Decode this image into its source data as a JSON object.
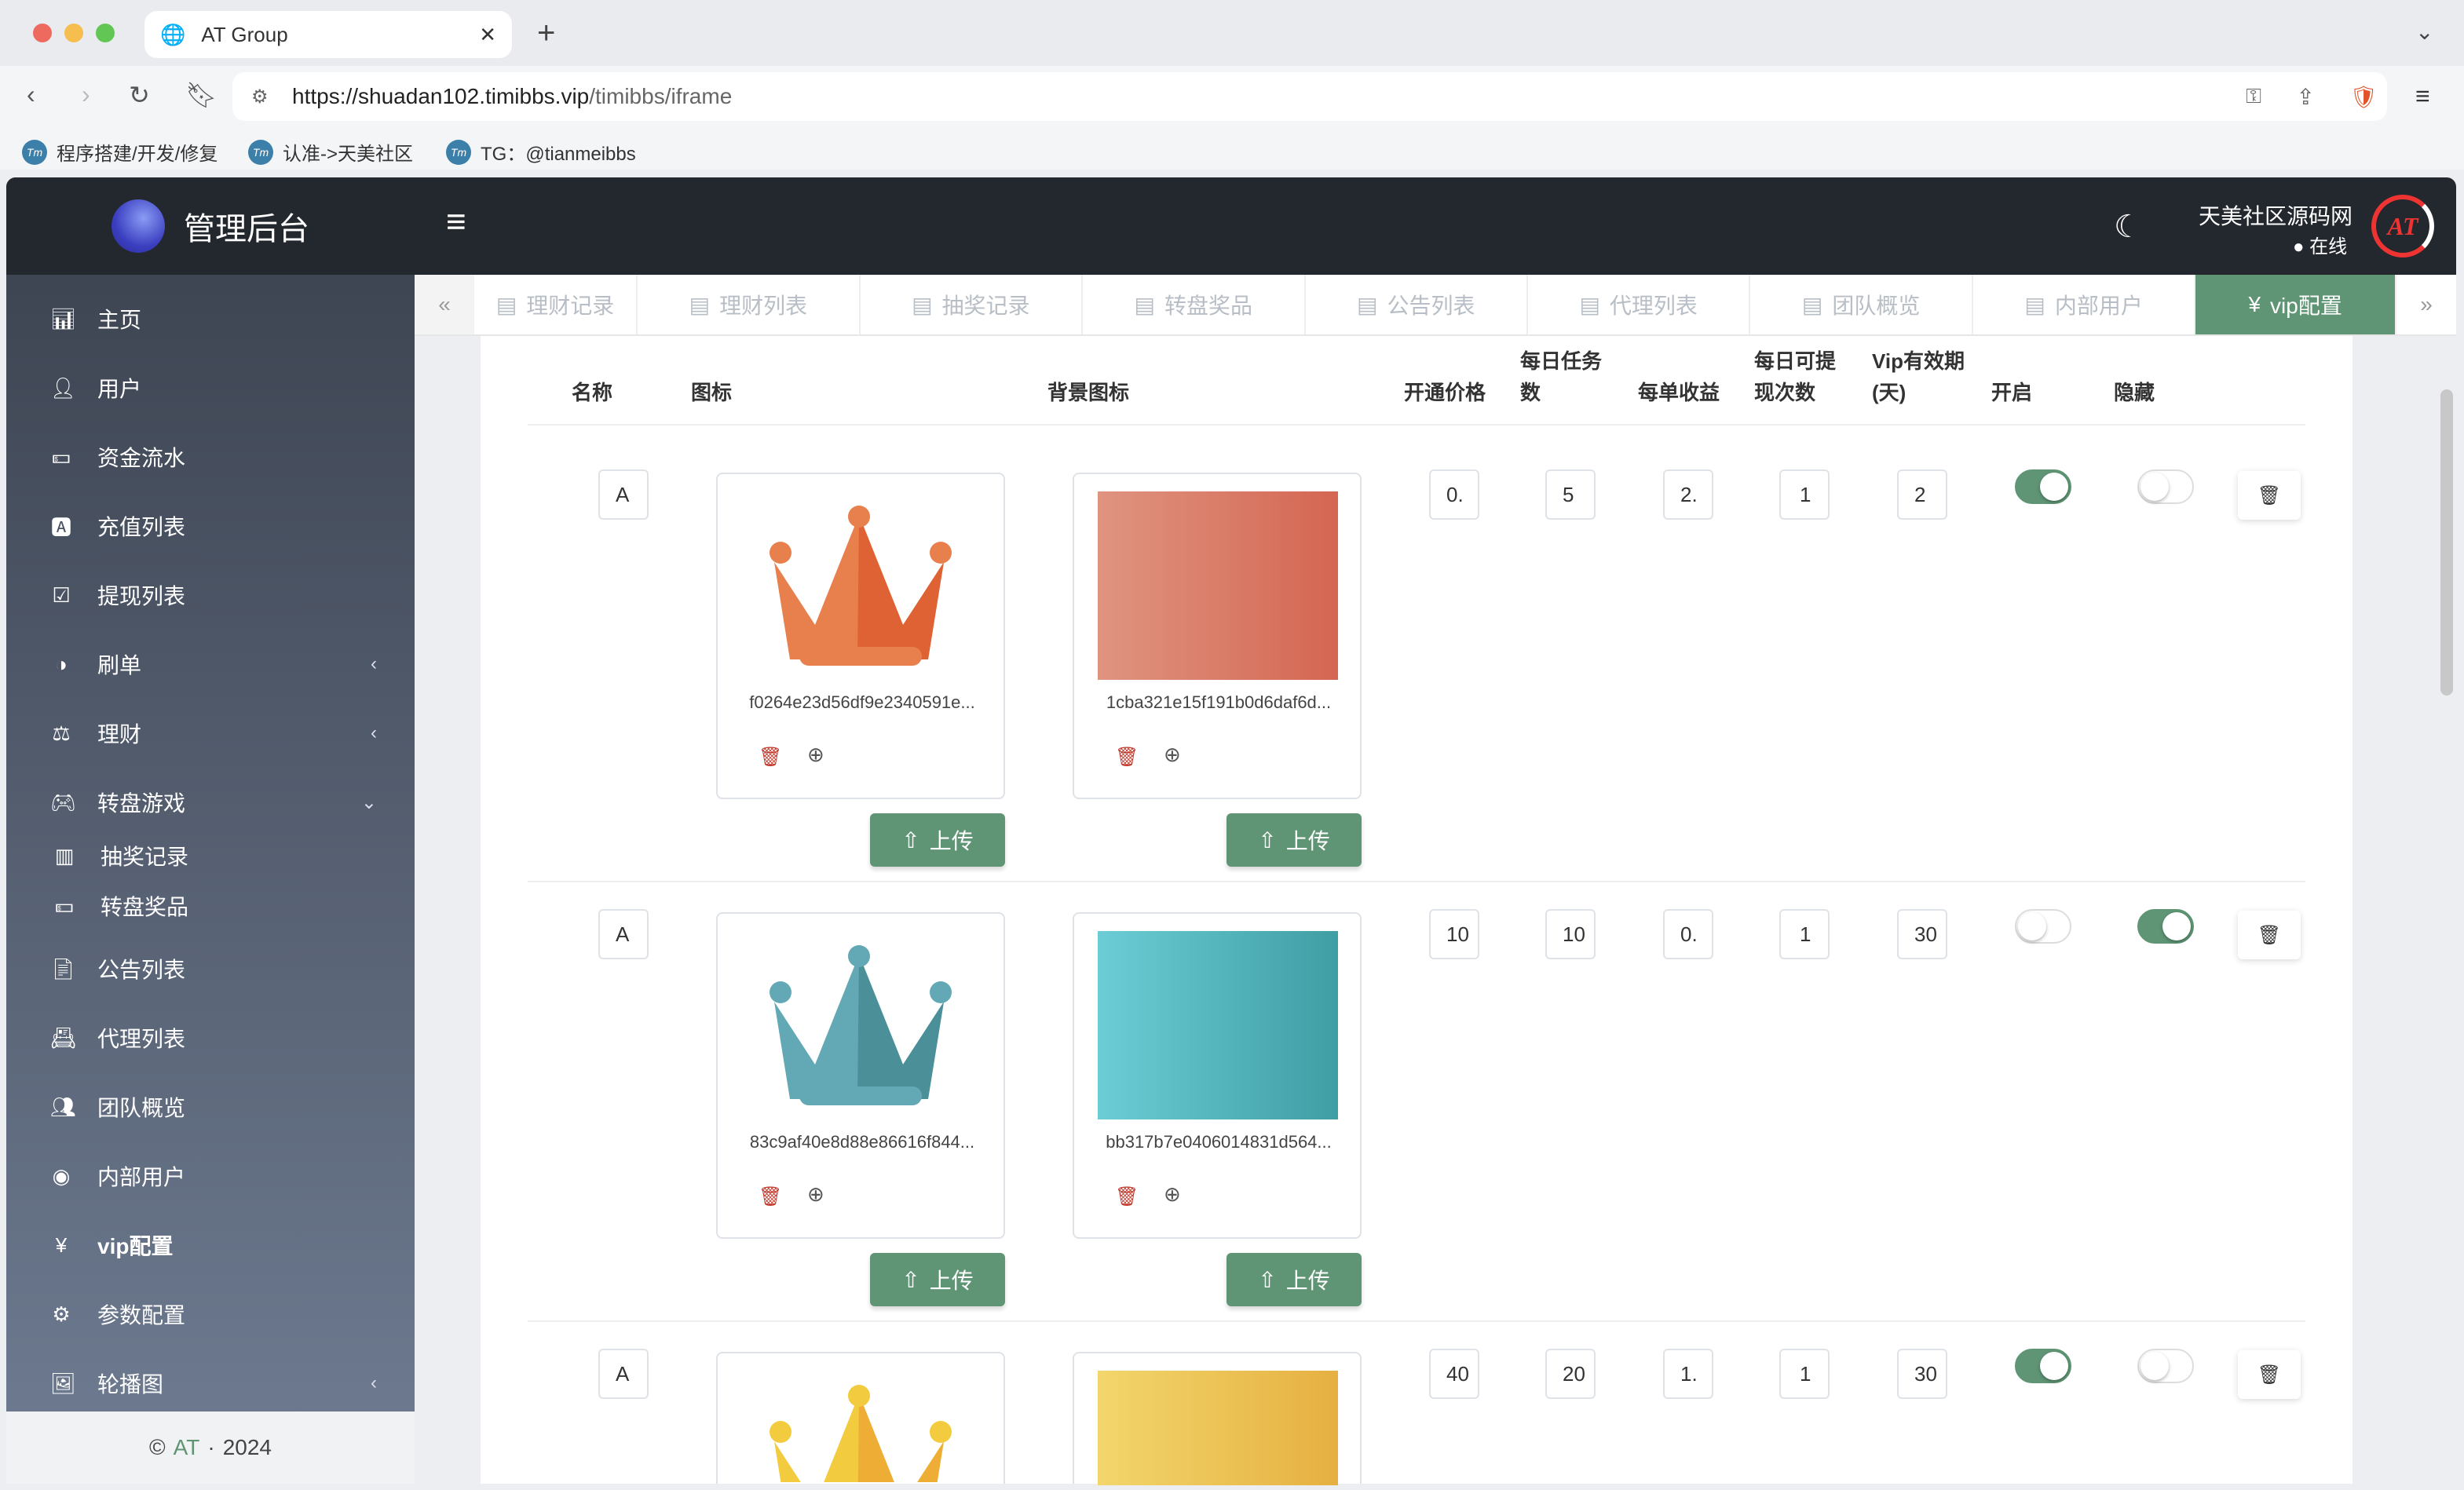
{
  "browser": {
    "tab_title": "AT Group",
    "url_host": "https://shuadan102.timibbs.vip",
    "url_path": "/timibbs/iframe",
    "bookmarks": [
      "程序搭建/开发/修复",
      "认准->天美社区",
      "TG：@tianmeibbs"
    ]
  },
  "sidebar": {
    "title": "管理后台",
    "items": [
      {
        "label": "主页",
        "icon": "bar-chart-icon"
      },
      {
        "label": "用户",
        "icon": "user-icon"
      },
      {
        "label": "资金流水",
        "icon": "money-icon"
      },
      {
        "label": "充值列表",
        "icon": "a-box-icon"
      },
      {
        "label": "提现列表",
        "icon": "check-box-icon"
      },
      {
        "label": "刷单",
        "icon": "half-circle-icon",
        "chev": "‹"
      },
      {
        "label": "理财",
        "icon": "coins-icon",
        "chev": "‹"
      },
      {
        "label": "转盘游戏",
        "icon": "gamepad-icon",
        "chev": "⌄"
      }
    ],
    "sub_items": [
      {
        "label": "抽奖记录"
      },
      {
        "label": "转盘奖品"
      }
    ],
    "items2": [
      {
        "label": "公告列表"
      },
      {
        "label": "代理列表"
      },
      {
        "label": "团队概览"
      },
      {
        "label": "内部用户"
      },
      {
        "label": "vip配置"
      },
      {
        "label": "参数配置"
      },
      {
        "label": "轮播图",
        "chev": "‹"
      }
    ],
    "footer": {
      "copy": "©",
      "brand": "AT",
      "sep": "·",
      "year": "2024"
    }
  },
  "header": {
    "user": "天美社区源码网",
    "status": "在线"
  },
  "tabs": [
    "理财记录",
    "理财列表",
    "抽奖记录",
    "转盘奖品",
    "公告列表",
    "代理列表",
    "团队概览",
    "内部用户",
    "vip配置"
  ],
  "table": {
    "headers": [
      "名称",
      "图标",
      "背景图标",
      "开通价格",
      "每日任务数",
      "每单收益",
      "每日可提现次数",
      "Vip有效期(天)",
      "开启",
      "隐藏"
    ],
    "upload_label": "上传",
    "rows": [
      {
        "name": "A",
        "icon_file": "f0264e23d56df9e2340591e...",
        "bg_file": "1cba321e15f191b0d6daf6d...",
        "price": "0.",
        "tasks": "5",
        "income": "2.",
        "withdraw": "1",
        "days": "2",
        "enabled": true,
        "hidden": false,
        "color": "#e8804e",
        "color2": "#df6234",
        "bg_from": "#df9480",
        "bg_to": "#d46652"
      },
      {
        "name": "A",
        "icon_file": "83c9af40e8d88e86616f844...",
        "bg_file": "bb317b7e0406014831d564...",
        "price": "10",
        "tasks": "10",
        "income": "0.",
        "withdraw": "1",
        "days": "30",
        "enabled": false,
        "hidden": true,
        "color": "#62a9b5",
        "color2": "#4b8f99",
        "bg_from": "#6ccdd6",
        "bg_to": "#3f9ea4"
      },
      {
        "name": "A",
        "icon_file": "",
        "bg_file": "",
        "price": "40",
        "tasks": "20",
        "income": "1.",
        "withdraw": "1",
        "days": "30",
        "enabled": true,
        "hidden": false,
        "color": "#f3cb3f",
        "color2": "#eeae35",
        "bg_from": "#f2d66c",
        "bg_to": "#e6b041"
      }
    ]
  }
}
